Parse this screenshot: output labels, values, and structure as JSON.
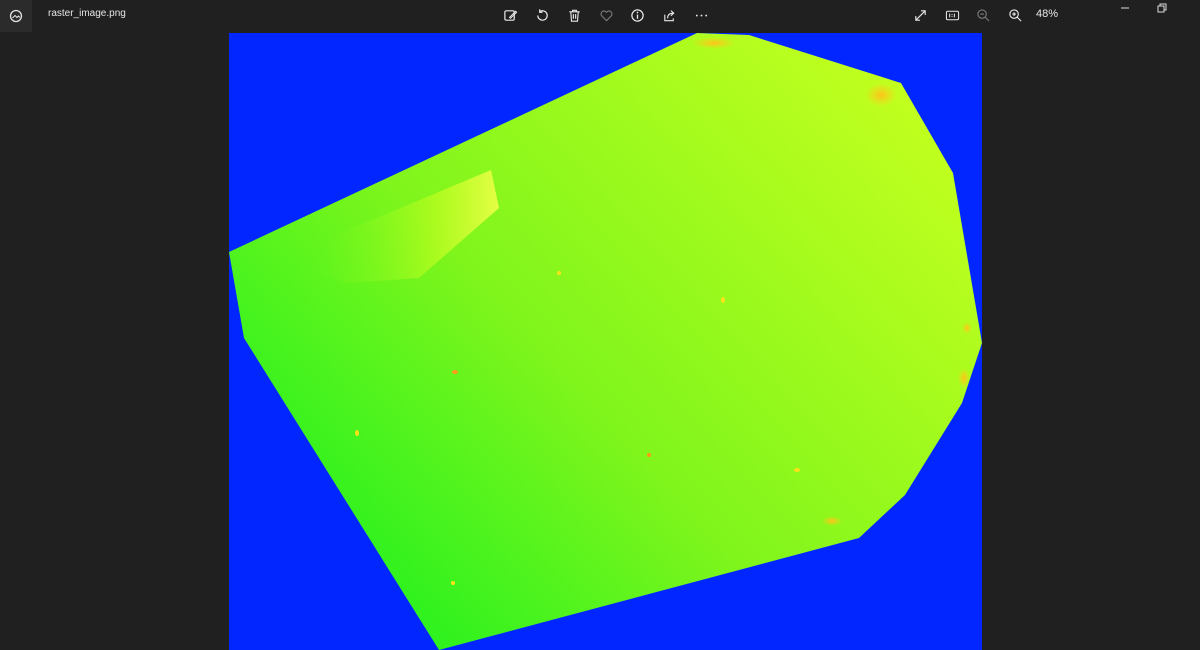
{
  "window": {
    "filename": "raster_image.png",
    "zoom_level": "48%"
  },
  "toolbar": {
    "buttons": [
      {
        "name": "edit-image-button",
        "icon": "edit-image-icon"
      },
      {
        "name": "rotate-button",
        "icon": "rotate-icon"
      },
      {
        "name": "delete-button",
        "icon": "trash-icon"
      },
      {
        "name": "favorite-button",
        "icon": "heart-icon"
      },
      {
        "name": "info-button",
        "icon": "info-icon"
      },
      {
        "name": "share-button",
        "icon": "share-icon"
      },
      {
        "name": "more-button",
        "icon": "more-icon"
      }
    ],
    "right_buttons": [
      {
        "name": "fullscreen-button",
        "icon": "expand-icon"
      },
      {
        "name": "actual-size-button",
        "icon": "actual-size-icon"
      },
      {
        "name": "zoom-out-button",
        "icon": "zoom-out-icon"
      },
      {
        "name": "zoom-in-button",
        "icon": "zoom-in-icon"
      }
    ]
  },
  "image": {
    "background_color": "#0126ff",
    "fill_colors": [
      "#00f020",
      "#7ff51c",
      "#c0ff1e"
    ],
    "hotspot_color": "#ffd21a"
  }
}
